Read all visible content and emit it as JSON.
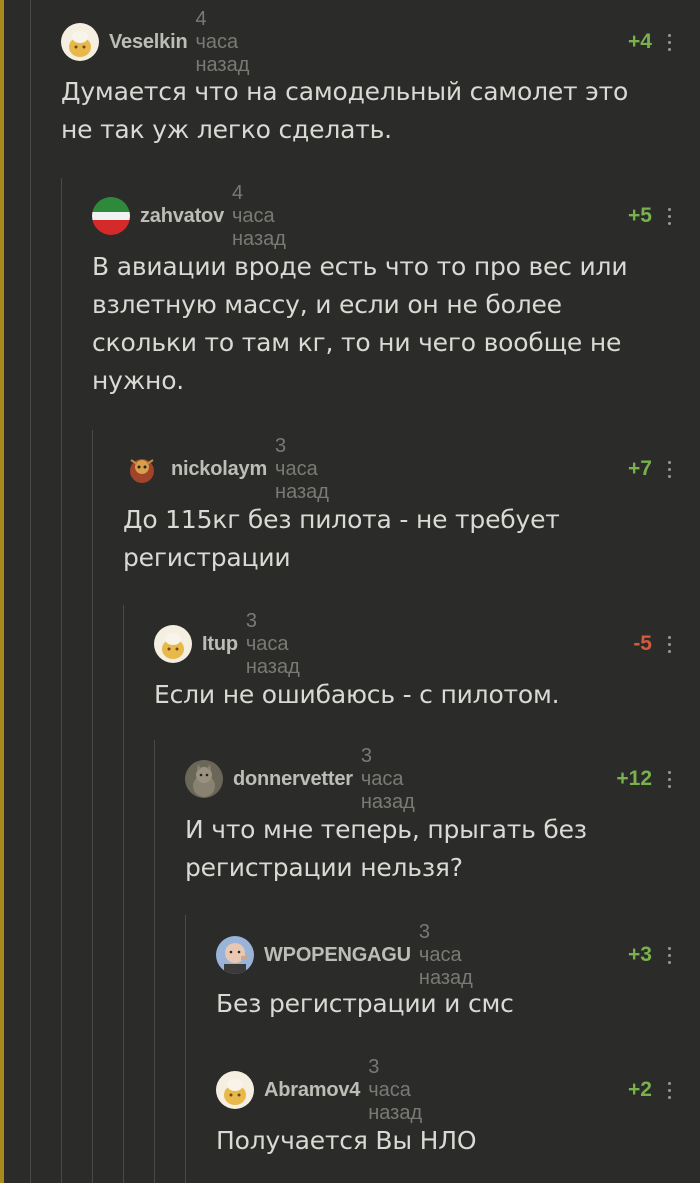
{
  "comments": [
    {
      "author": "Veselkin",
      "time": "4 часа назад",
      "rating": "+4",
      "text": "Думается что на самодельный самолет это\nне так уж легко сделать.",
      "avatar": "yellow-face"
    },
    {
      "author": "zahvatov",
      "time": "4 часа назад",
      "rating": "+5",
      "text": "В авиации вроде есть что то про вес или\nвзлетную массу, и если он не более\nскольки то там кг, то ни чего вообще не\nнужно.",
      "avatar": "tatar-flag"
    },
    {
      "author": "nickolaym",
      "time": "3 часа назад",
      "rating": "+7",
      "text": "До 115кг без пилота - не требует\nрегистрации",
      "avatar": "creature"
    },
    {
      "author": "Itup",
      "time": "3 часа назад",
      "rating": "-5",
      "text": "Если не ошибаюсь - с пилотом.",
      "avatar": "yellow-face"
    },
    {
      "author": "donnervetter",
      "time": "3 часа назад",
      "rating": "+12",
      "text": "И что мне теперь, прыгать без\nрегистрации нельзя?",
      "avatar": "cat"
    },
    {
      "author": "WPOPENGAGU",
      "time": "3 часа назад",
      "rating": "+3",
      "text": "Без регистрации и смс",
      "avatar": "dr-evil"
    },
    {
      "author": "Abramov4",
      "time": "3 часа назад",
      "rating": "+2",
      "text": "Получается Вы НЛО",
      "avatar": "yellow-face"
    }
  ],
  "colors": {
    "background": "#2b2b29",
    "accent_bar": "#a88a1c",
    "positive_rating": "#78b14e",
    "negative_rating": "#d35a3c"
  }
}
